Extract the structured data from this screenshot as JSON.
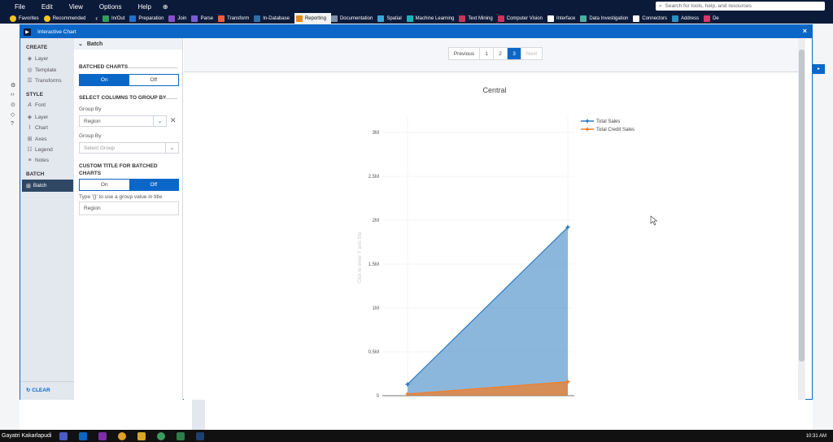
{
  "menu": [
    "File",
    "Edit",
    "View",
    "Options",
    "Help"
  ],
  "search_placeholder": "Search for tools, help, and resources",
  "palette_tabs": [
    {
      "label": "Favorites",
      "color": "#f5c518"
    },
    {
      "label": "Recommended",
      "color": "#f5c518"
    },
    {
      "label": "In/Out",
      "color": "#2e9c5a"
    },
    {
      "label": "Preparation",
      "color": "#1f6fd1"
    },
    {
      "label": "Join",
      "color": "#8a4fc7"
    },
    {
      "label": "Parse",
      "color": "#7a5bd6"
    },
    {
      "label": "Transform",
      "color": "#e8613a"
    },
    {
      "label": "In-Database",
      "color": "#2f6ea8"
    },
    {
      "label": "Reporting",
      "color": "#e58a1f",
      "active": true
    },
    {
      "label": "Documentation",
      "color": "#7f8fa6"
    },
    {
      "label": "Spatial",
      "color": "#3aa6d9"
    },
    {
      "label": "Machine Learning",
      "color": "#19b3b8"
    },
    {
      "label": "Text Mining",
      "color": "#c7355a"
    },
    {
      "label": "Computer Vision",
      "color": "#c7355a"
    },
    {
      "label": "Interface",
      "color": "#ffffff"
    },
    {
      "label": "Data Investigation",
      "color": "#4bb0a0"
    },
    {
      "label": "Connectors",
      "color": "#ffffff"
    },
    {
      "label": "Address",
      "color": "#2e8fbf"
    },
    {
      "label": "De",
      "color": "#e0336a"
    }
  ],
  "dialog": {
    "title": "Interactive Chart",
    "close": "×"
  },
  "nav": {
    "create_label": "CREATE",
    "create_items": [
      "Layer",
      "Template",
      "Transforms"
    ],
    "style_label": "STYLE",
    "style_items": [
      "Font",
      "Layer",
      "Chart",
      "Axes",
      "Legend",
      "Notes"
    ],
    "batch_label": "BATCH",
    "batch_item": "Batch",
    "clear": "CLEAR"
  },
  "panel": {
    "header": "Batch",
    "batched_charts": "BATCHED CHARTS",
    "on": "On",
    "off": "Off",
    "select_columns": "SELECT COLUMNS TO GROUP BY",
    "group_by": "Group By",
    "group_value": "Region",
    "group_by2": "Group By",
    "select_group_placeholder": "Select Group",
    "custom_title": "CUSTOM TITLE FOR BATCHED CHARTS",
    "hint": "Type '{}' to use a group value in title",
    "title_value": "Region"
  },
  "pager": {
    "previous": "Previous",
    "pages": [
      "1",
      "2",
      "3"
    ],
    "next": "Next",
    "current": "3"
  },
  "chart_data": {
    "type": "area",
    "title": "Central",
    "ylabel_placeholder": "Click to enter Y axis title",
    "x": [
      0,
      1
    ],
    "series": [
      {
        "name": "Total Sales",
        "values": [
          130000,
          1920000
        ],
        "color": "#2e7bbf"
      },
      {
        "name": "Total Credit Sales",
        "values": [
          20000,
          160000
        ],
        "color": "#f07f2a"
      }
    ],
    "yticks": [
      "0",
      "0.5M",
      "1M",
      "1.5M",
      "2M",
      "2.5M",
      "3M"
    ],
    "ylim": [
      0,
      3000000
    ],
    "grid": true,
    "legend_position": "top-right"
  },
  "taskbar": {
    "user": "Gayatri Kakarlapudi",
    "time": "10:31 AM"
  }
}
